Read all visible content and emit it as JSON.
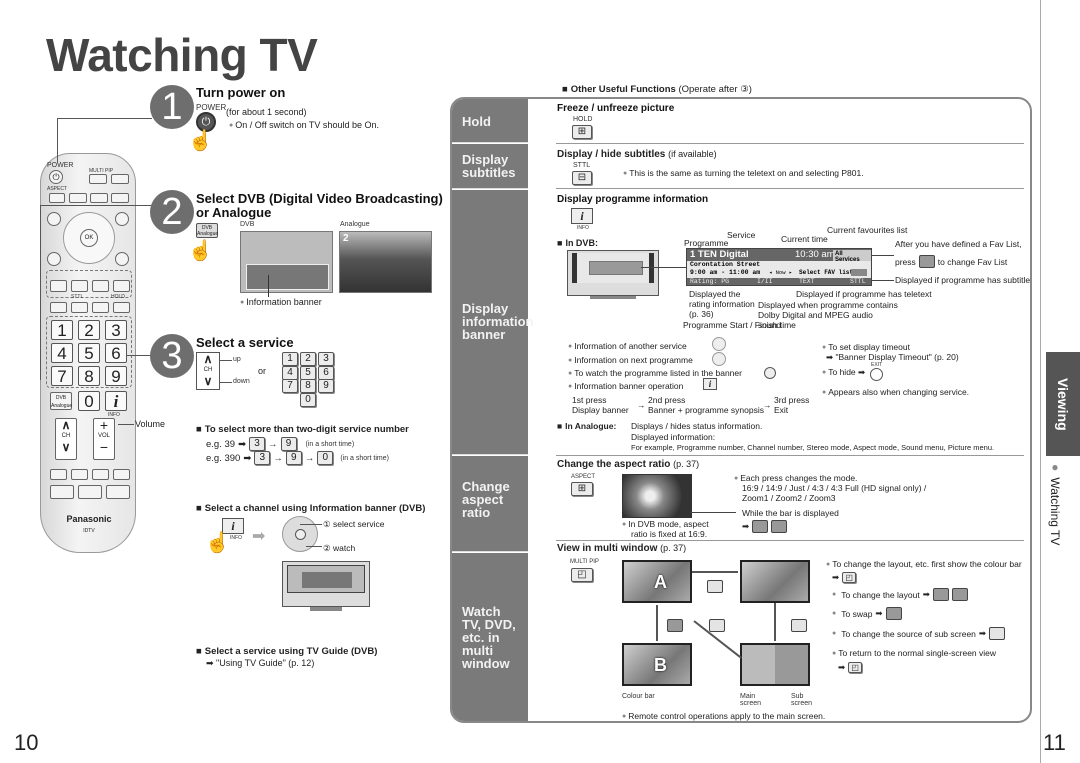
{
  "page": {
    "title": "Watching TV",
    "left_page_number": "10",
    "right_page_number": "11"
  },
  "side_index": {
    "section_tab": "Viewing",
    "current_topic": "Watching TV"
  },
  "remote": {
    "brand": "Panasonic",
    "model": "IDTV",
    "labels": {
      "power": "POWER",
      "multi_pip": "MULTI PIP",
      "aspect": "ASPECT",
      "ok": "OK",
      "color_keys": [
        "R",
        "G",
        "Y",
        "B"
      ],
      "sttl": "STTL",
      "hold": "HOLD",
      "dvb_analogue": "DVB Analogue",
      "info": "INFO",
      "ch": "CH",
      "vol": "VOL",
      "volume_callout": "Volume"
    },
    "digits": [
      "1",
      "2",
      "3",
      "4",
      "5",
      "6",
      "7",
      "8",
      "9",
      "0"
    ]
  },
  "steps": [
    {
      "number": "1",
      "heading": "Turn power on",
      "key_label": "POWER",
      "note": "(for about 1 second)",
      "bullet": "On / Off switch on TV should be On."
    },
    {
      "number": "2",
      "heading_line1": "Select DVB (Digital Video Broadcasting)",
      "heading_line2": "or Analogue",
      "key_label": "DVB Analogue",
      "dvb_label": "DVB",
      "analogue_label": "Analogue",
      "analogue_channel": "2",
      "bullet": "Information banner"
    },
    {
      "number": "3",
      "heading": "Select a service",
      "ch_label": "CH",
      "up_label": "up",
      "down_label": "down",
      "or_label": "or",
      "digits": [
        "1",
        "2",
        "3",
        "4",
        "5",
        "6",
        "7",
        "8",
        "9",
        "0"
      ]
    }
  ],
  "multi_digit": {
    "heading": "To select more than two-digit service number",
    "example1": {
      "prefix": "e.g. 39",
      "keys": [
        "3",
        "9"
      ],
      "note": "(in a short time)"
    },
    "example2": {
      "prefix": "e.g. 390",
      "keys": [
        "3",
        "9",
        "0"
      ],
      "note": "(in a short time)"
    }
  },
  "info_banner_select": {
    "heading": "Select a channel using Information banner (DVB)",
    "info_key": "INFO",
    "step1": "① select service",
    "step2": "② watch"
  },
  "tv_guide": {
    "heading": "Select a service using TV Guide (DVB)",
    "ref": "\"Using TV Guide\" (p. 12)"
  },
  "other_functions": {
    "heading": "Other Useful Functions",
    "note": "(Operate after ③)",
    "sections": [
      {
        "side_label": "Hold",
        "title": "Freeze / unfreeze picture",
        "key_label": "HOLD"
      },
      {
        "side_label": "Display subtitles",
        "title": "Display / hide subtitles",
        "title_note": "(if available)",
        "key_label": "STTL",
        "bullet": "This is the same as turning the teletext on and selecting P801."
      },
      {
        "side_label": "Display information banner",
        "title": "Display programme information",
        "key_label": "INFO",
        "in_dvb_label": "In DVB:",
        "banner": {
          "channel": "1  TEN Digital",
          "time": "10:30 am",
          "fav": "All Services",
          "programme": "Corontation Street",
          "start_finish": "9:00 am - 11:00 am",
          "now": "◂ Now ▸",
          "select_fav": "Select FAV list",
          "rating": "Rating: PG",
          "audio": "I/II",
          "text": "TEXT",
          "sttl": "STTL"
        },
        "callouts": {
          "programme": "Programme",
          "service": "Service",
          "current_time": "Current time",
          "current_fav": "Current favourites list",
          "after_fav": "After you have defined a Fav List,",
          "press": "press",
          "press_key": "B",
          "change_fav": "to change Fav List",
          "subtitle": "Displayed if programme has subtitle",
          "teletext": "Displayed if programme has teletext",
          "rating": "Displayed the rating information (p. 36)",
          "dolby": "Displayed when programme contains Dolby Digital and MPEG audio sound",
          "start_finish": "Programme Start / Finish time"
        },
        "bullets_left": [
          "Information of another service",
          "Information on next programme",
          "To watch the programme listed in the banner",
          "Information banner operation"
        ],
        "presses": {
          "first": "1st press",
          "first_desc": "Display banner",
          "second": "2nd press",
          "second_desc": "Banner + programme synopsis",
          "third": "3rd press",
          "third_desc": "Exit"
        },
        "bullets_right": {
          "timeout": "To set display timeout",
          "timeout_ref": "\"Banner Display Timeout\" (p. 20)",
          "hide": "To hide",
          "exit_key": "EXIT",
          "appears": "Appears also when changing service."
        },
        "analogue": {
          "label": "In Analogue:",
          "line1": "Displays / hides status information.",
          "line2": "Displayed information:",
          "line3": "For example, Programme number, Channel number, Stereo mode, Aspect mode, Sound menu, Picture menu."
        }
      },
      {
        "side_label": "Change aspect ratio",
        "title": "Change the aspect ratio",
        "title_note": "(p. 37)",
        "key_label": "ASPECT",
        "bullet1": "Each press changes the mode.",
        "modes_line1": "16:9 / 14:9 / Just / 4:3 / 4:3 Full (HD signal only) /",
        "modes_line2": "Zoom1 / Zoom2 / Zoom3",
        "bar_note": "While the bar is displayed",
        "bar_keys": [
          "R",
          "G"
        ],
        "dvb_note": "In DVB mode, aspect ratio is fixed at 16:9."
      },
      {
        "side_label": "Watch TV, DVD, etc. in multi window",
        "title": "View in multi window",
        "title_note": "(p. 37)",
        "key_label": "MULTI PIP",
        "screen_a": "A",
        "screen_b": "B",
        "transition_keys": [
          "R",
          "B",
          "R",
          "R"
        ],
        "colour_bar": "Colour bar",
        "main_screen": "Main screen",
        "sub_screen": "Sub screen",
        "bullets": [
          "To change the layout, etc. first show the colour bar",
          "To change the layout",
          "To swap",
          "To change the source of sub screen",
          "To return to the normal single-screen view"
        ],
        "bullet_keys": {
          "layout": [
            "R",
            "G"
          ],
          "swap": "B",
          "source": "Y",
          "return": "MULTI PIP"
        },
        "footer": "Remote control operations apply to the main screen."
      }
    ]
  }
}
